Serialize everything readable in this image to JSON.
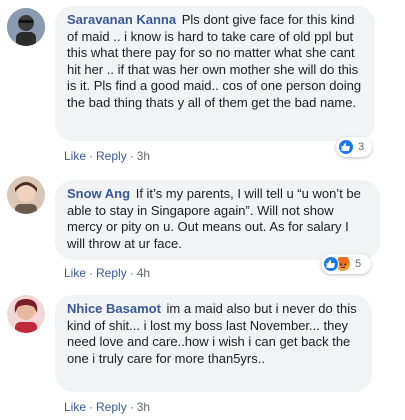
{
  "comments": [
    {
      "author": "Saravanan Kanna",
      "text": "Pls dont give face for this kind of maid .. i know is hard to take care of old ppl but this what there pay for so no matter what she cant hit her .. if that was her own mother she will do this is it. Pls find a good maid.. cos of one person doing the bad thing thats y all of them get the bad name.",
      "like_label": "Like",
      "reply_label": "Reply",
      "time": "3h",
      "reaction_count": "3",
      "reactions": [
        "like-icon"
      ]
    },
    {
      "author": "Snow Ang",
      "text": "If it’s my parents, I will tell u “u won’t be able to stay in Singapore again”. Will not show mercy or pity on u. Out means out. As for salary I will throw at ur face.",
      "like_label": "Like",
      "reply_label": "Reply",
      "time": "4h",
      "reaction_count": "5",
      "reactions": [
        "like-icon",
        "angry-icon"
      ]
    },
    {
      "author": "Nhice Basamot",
      "text": "im a maid also but i never do this kind of shit... i lost my boss last November... they need love and care..how i wish i can get back the one i truly care for more than5yrs..",
      "like_label": "Like",
      "reply_label": "Reply",
      "time": "3h",
      "reaction_count": "",
      "reactions": []
    }
  ],
  "colors": {
    "link": "#385898",
    "bubble": "#f2f3f5",
    "like": "#1877f2",
    "angry": "#e9710f"
  }
}
